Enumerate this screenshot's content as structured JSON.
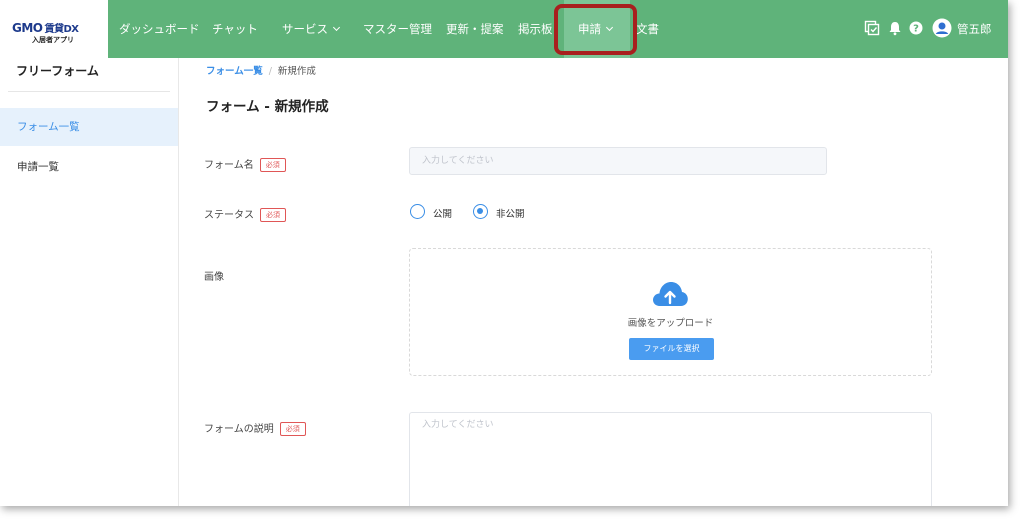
{
  "brand": {
    "name": "GMO",
    "product": "賃貸DX",
    "subtitle": "入居者アプリ",
    "accent": "#5fb37a"
  },
  "nav": {
    "items": [
      {
        "label": "ダッシュボード"
      },
      {
        "label": "チャット"
      },
      {
        "label": "サービス"
      },
      {
        "label": "マスター管理"
      },
      {
        "label": "更新・提案"
      },
      {
        "label": "掲示板"
      },
      {
        "label": "申請"
      },
      {
        "label": "文書"
      }
    ],
    "user_name": "管五郎",
    "icons": [
      "checklist-icon",
      "bell-icon",
      "help-icon",
      "avatar-icon",
      "chevron-down-icon"
    ]
  },
  "sidebar": {
    "title": "フリーフォーム",
    "items": [
      {
        "label": "フォーム一覧"
      },
      {
        "label": "申請一覧"
      }
    ]
  },
  "breadcrumb": {
    "parent": "フォーム一覧",
    "current": "新規作成"
  },
  "page": {
    "title": "フォーム - 新規作成"
  },
  "form": {
    "required_badge": "必須",
    "name": {
      "label": "フォーム名",
      "placeholder": "入力してください"
    },
    "status": {
      "label": "ステータス",
      "options": [
        "公開",
        "非公開"
      ],
      "selected": "非公開"
    },
    "image": {
      "label": "画像",
      "upload_text": "画像をアップロード",
      "button": "ファイルを選択"
    },
    "description": {
      "label": "フォームの説明",
      "placeholder": "入力してください"
    }
  }
}
